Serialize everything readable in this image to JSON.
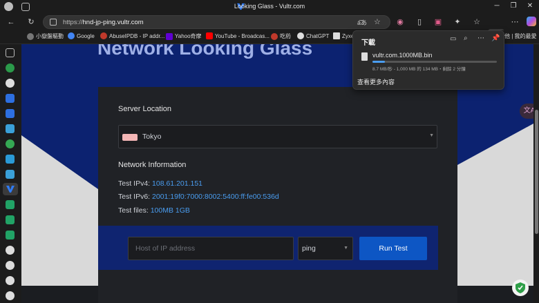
{
  "window": {
    "title": "Looking Glass - Vultr.com"
  },
  "toolbar": {
    "url_prefix": "https://",
    "url_host": "hnd-jp-ping.vultr.com"
  },
  "bookmarks": [
    {
      "label": "小嶽盤驅動",
      "color": "#777777"
    },
    {
      "label": "Google",
      "color": "#4285f4"
    },
    {
      "label": "AbuseIPDB - IP addr...",
      "color": "#c0392b"
    },
    {
      "label": "Yahoo奇摩",
      "color": "#6001d2"
    },
    {
      "label": "YouTube - Broadcas...",
      "color": "#ff0000"
    },
    {
      "label": "吃葯",
      "color": "#c0392b"
    },
    {
      "label": "ChatGPT",
      "color": "#dddddd"
    },
    {
      "label": "Zyxe",
      "color": "#dddddd"
    },
    {
      "label": "他 | 我的最愛",
      "color": "#999999"
    }
  ],
  "downloads": {
    "title": "下載",
    "file_name": "vultr.com.1000MB.bin",
    "progress": 0.008,
    "status": "8.7 MB/秒 - 1,000 MB 的 134 MB・剩餘 2 分鐘",
    "more_link": "查看更多內容"
  },
  "page": {
    "hero_title": "Network Looking Glass",
    "server_location_heading": "Server Location",
    "location_value": "Tokyo",
    "network_info_heading": "Network Information",
    "ipv4_label": "Test IPv4:",
    "ipv4_value": "108.61.201.151",
    "ipv6_label": "Test IPv6:",
    "ipv6_value": "2001:19f0:7000:8002:5400:ff:fe00:536d",
    "files_label": "Test files:",
    "file_100mb": "100MB",
    "file_1gb": "1GB",
    "host_placeholder": "Host of IP address",
    "method_value": "ping",
    "run_button": "Run Test"
  },
  "colors": {
    "accent_blue": "#0d56c4",
    "link_blue": "#4a9df0",
    "hero_navy": "#0c2270"
  }
}
